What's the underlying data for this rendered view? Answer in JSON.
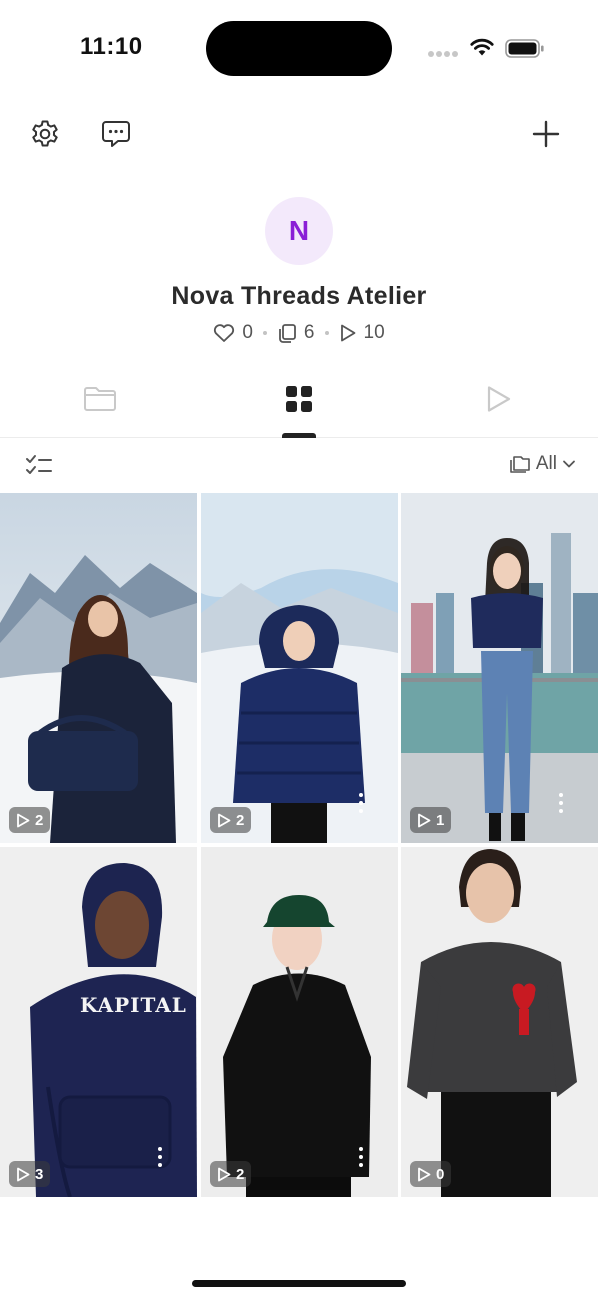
{
  "status_bar": {
    "time": "11:10"
  },
  "profile": {
    "avatar_initial": "N",
    "name": "Nova Threads Atelier",
    "stats": {
      "likes": "0",
      "posts": "6",
      "plays": "10"
    }
  },
  "filter": {
    "album_label": "All"
  },
  "grid": {
    "items": [
      {
        "plays": "2"
      },
      {
        "plays": "2"
      },
      {
        "plays": "1"
      },
      {
        "plays": "3",
        "garment_text": "KAPITAL"
      },
      {
        "plays": "2"
      },
      {
        "plays": "0"
      }
    ]
  },
  "colors": {
    "accent": "#8a1fd6",
    "avatar_bg": "#f3e9fb",
    "text": "#2b2b2b"
  }
}
